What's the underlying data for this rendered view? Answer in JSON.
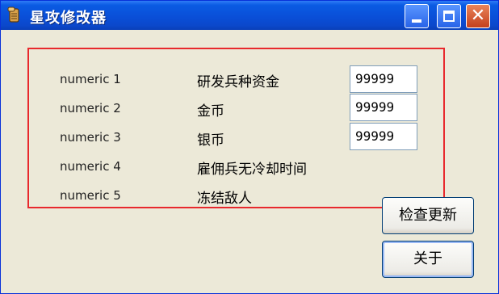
{
  "window": {
    "title": "星攻修改器"
  },
  "rows": [
    {
      "label": "numeric 1",
      "name": "研发兵种资金",
      "value": "99999"
    },
    {
      "label": "numeric 2",
      "name": "金币",
      "value": "99999"
    },
    {
      "label": "numeric 3",
      "name": "银币",
      "value": "99999"
    },
    {
      "label": "numeric 4",
      "name": "雇佣兵无冷却时间"
    },
    {
      "label": "numeric 5",
      "name": "冻结敌人"
    }
  ],
  "buttons": {
    "check_update": "检查更新",
    "about": "关于"
  },
  "icons": {
    "app": "scroll-icon",
    "minimize": "minimize-icon",
    "maximize": "maximize-icon",
    "close": "close-icon"
  },
  "colors": {
    "title_bar": "#0a4fd8",
    "highlight_box": "#e8292d",
    "close_button": "#c4401c"
  }
}
